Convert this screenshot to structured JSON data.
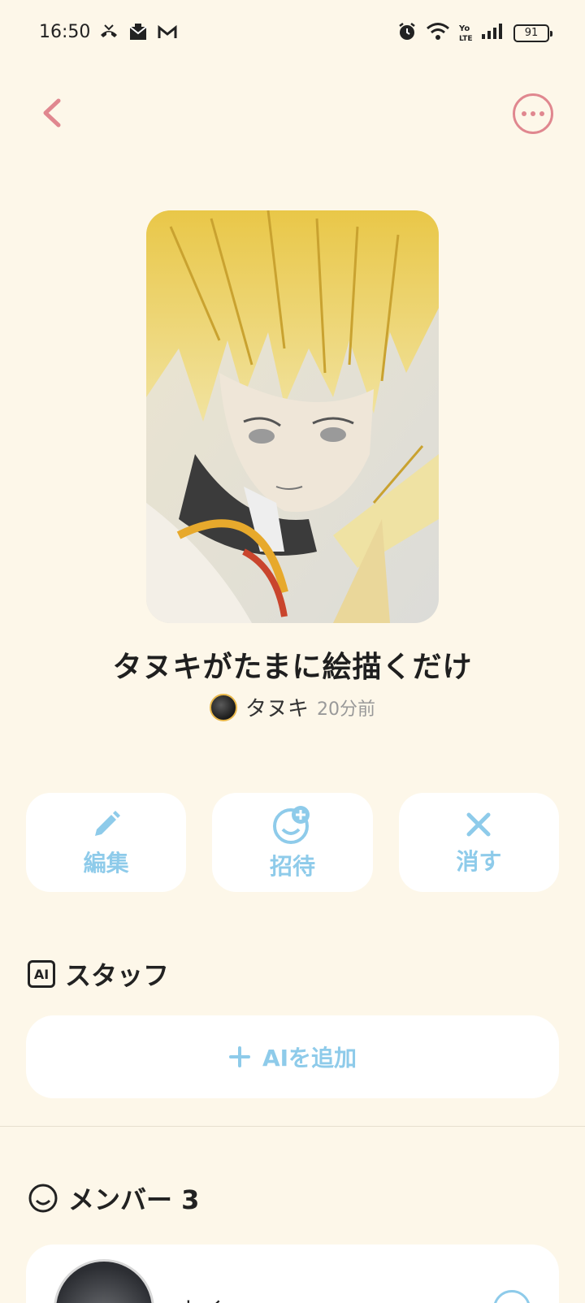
{
  "status_bar": {
    "time": "16:50",
    "battery": "91",
    "icons": [
      "missed-call-icon",
      "mail-icon",
      "gmail-icon",
      "alarm-icon",
      "wifi-icon",
      "volte-icon",
      "signal-icon",
      "battery-icon"
    ]
  },
  "nav": {
    "back_icon": "chevron-left-icon",
    "more_icon": "more-horizontal-icon"
  },
  "room": {
    "title": "タヌキがたまに絵描くだけ",
    "owner_name": "タヌキ",
    "time_ago": "20分前"
  },
  "actions": [
    {
      "label": "編集",
      "icon": "pencil-icon"
    },
    {
      "label": "招待",
      "icon": "invite-icon"
    },
    {
      "label": "消す",
      "icon": "close-icon"
    }
  ],
  "staff_section": {
    "badge": "AI",
    "title": "スタッフ",
    "add_label": "AIを追加"
  },
  "members_section": {
    "title": "メンバー 3",
    "first_member_name": "トイ"
  },
  "colors": {
    "background": "#fdf7e9",
    "accent_pink": "#e0878f",
    "accent_blue": "#8ecbea",
    "card": "#ffffff"
  }
}
